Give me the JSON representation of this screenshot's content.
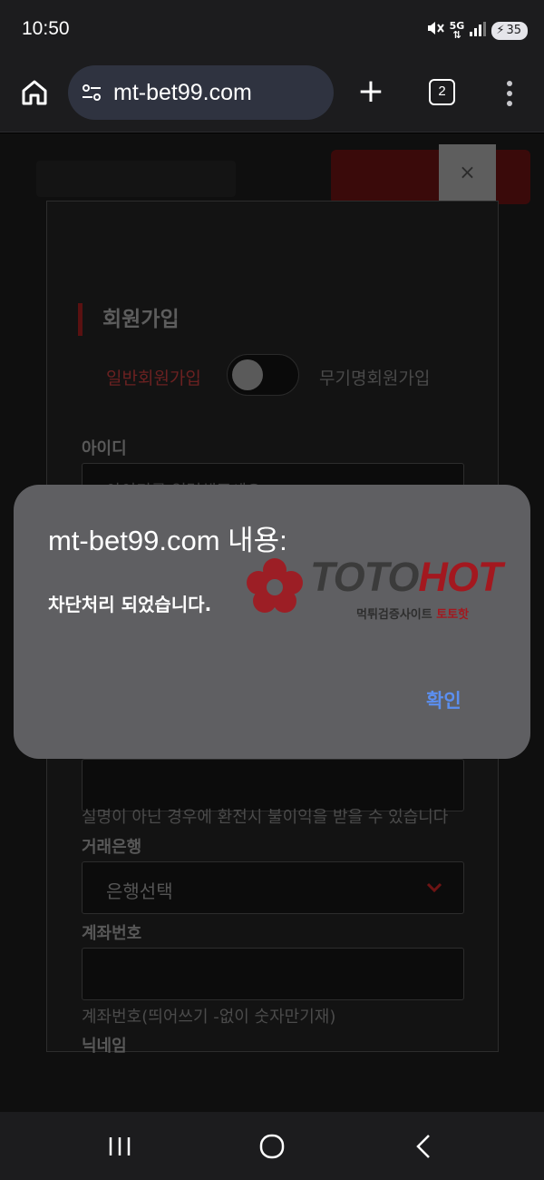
{
  "status_bar": {
    "time": "10:50",
    "signal_label": "5G",
    "battery": "35"
  },
  "browser": {
    "url": "mt-bet99.com",
    "tab_count": "2"
  },
  "page": {
    "signup": {
      "title": "회원가입",
      "member_type_normal": "일반회원가입",
      "member_type_anonymous": "무기명회원가입",
      "id_label": "아이디",
      "id_placeholder": "아이디를 입력해주세요",
      "realname_hint": "실명이 아닌 경우에 환전시 불이익을 받을 수 있습니다",
      "bank_label": "거래은행",
      "bank_select_value": "은행선택",
      "account_label": "계좌번호",
      "account_hint": "계좌번호(띄어쓰기 -없이 숫자만기재)",
      "nickname_label": "닉네임",
      "close_symbol": "×"
    }
  },
  "dialog": {
    "title": "mt-bet99.com 내용:",
    "message": "차단처리 되었습니다.",
    "ok_label": "확인"
  },
  "watermark": {
    "brand_part1": "TOTO",
    "brand_part2": "HOT",
    "tagline_part1": "먹튀검증사이트",
    "tagline_part2": "토토핫"
  },
  "colors": {
    "accent_red": "#a3181f",
    "dialog_bg": "#5f5f62",
    "link_blue": "#5b8ff0"
  }
}
